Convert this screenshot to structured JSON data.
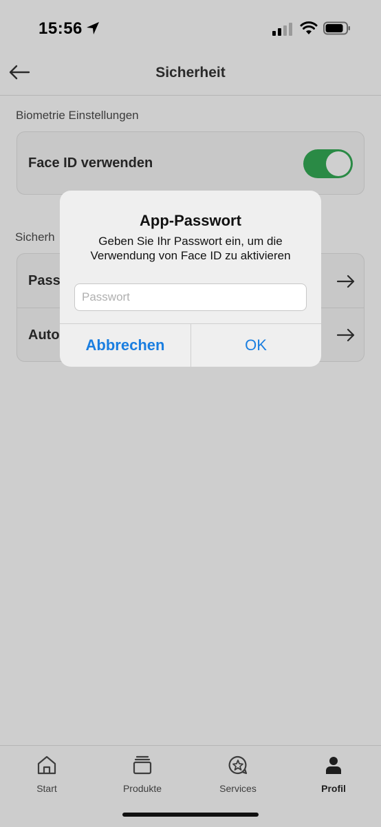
{
  "status_bar": {
    "time": "15:56"
  },
  "nav": {
    "title": "Sicherheit"
  },
  "biometrics": {
    "section_title": "Biometrie Einstellungen",
    "face_id_label": "Face ID verwenden",
    "face_id_enabled": true
  },
  "security": {
    "section_title_visible": "Sicherh",
    "rows": [
      {
        "label_visible": "Pass"
      },
      {
        "label_visible": "Auto"
      }
    ]
  },
  "dialog": {
    "title": "App-Passwort",
    "message": "Geben Sie Ihr Passwort ein, um die Verwendung von Face ID zu aktivieren",
    "password_placeholder": "Passwort",
    "cancel_label": "Abbrechen",
    "ok_label": "OK"
  },
  "tabs": [
    {
      "label": "Start",
      "icon": "home-icon"
    },
    {
      "label": "Produkte",
      "icon": "products-icon"
    },
    {
      "label": "Services",
      "icon": "services-icon"
    },
    {
      "label": "Profil",
      "icon": "profile-icon",
      "active": true
    }
  ],
  "colors": {
    "toggle_on": "#2a8a45",
    "dialog_button": "#1a7ee0",
    "overlay_background": "#cecece"
  }
}
